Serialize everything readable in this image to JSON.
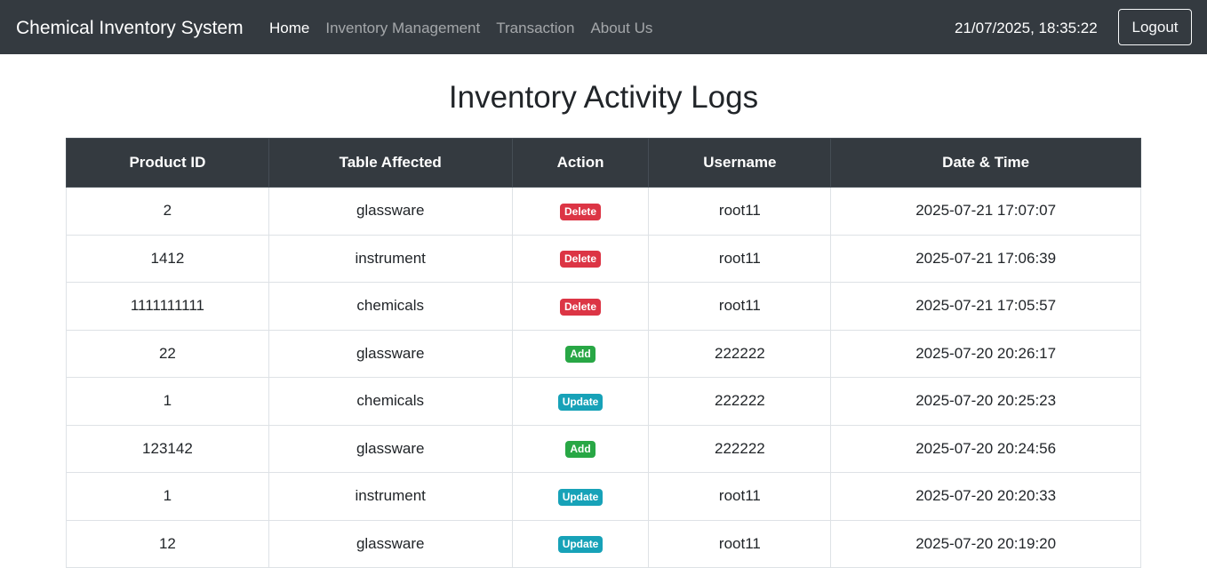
{
  "navbar": {
    "brand": "Chemical Inventory System",
    "links": [
      {
        "label": "Home",
        "active": true
      },
      {
        "label": "Inventory Management",
        "active": false
      },
      {
        "label": "Transaction",
        "active": false
      },
      {
        "label": "About Us",
        "active": false
      }
    ],
    "datetime": "21/07/2025, 18:35:22",
    "logout_label": "Logout"
  },
  "page": {
    "title": "Inventory Activity Logs"
  },
  "table": {
    "headers": [
      "Product ID",
      "Table Affected",
      "Action",
      "Username",
      "Date & Time"
    ],
    "rows": [
      {
        "product_id": "2",
        "table": "glassware",
        "action": "Delete",
        "username": "root11",
        "datetime": "2025-07-21 17:07:07"
      },
      {
        "product_id": "1412",
        "table": "instrument",
        "action": "Delete",
        "username": "root11",
        "datetime": "2025-07-21 17:06:39"
      },
      {
        "product_id": "1111111111",
        "table": "chemicals",
        "action": "Delete",
        "username": "root11",
        "datetime": "2025-07-21 17:05:57"
      },
      {
        "product_id": "22",
        "table": "glassware",
        "action": "Add",
        "username": "222222",
        "datetime": "2025-07-20 20:26:17"
      },
      {
        "product_id": "1",
        "table": "chemicals",
        "action": "Update",
        "username": "222222",
        "datetime": "2025-07-20 20:25:23"
      },
      {
        "product_id": "123142",
        "table": "glassware",
        "action": "Add",
        "username": "222222",
        "datetime": "2025-07-20 20:24:56"
      },
      {
        "product_id": "1",
        "table": "instrument",
        "action": "Update",
        "username": "root11",
        "datetime": "2025-07-20 20:20:33"
      },
      {
        "product_id": "12",
        "table": "glassware",
        "action": "Update",
        "username": "root11",
        "datetime": "2025-07-20 20:19:20"
      }
    ]
  },
  "colors": {
    "navbar_bg": "#343a40",
    "delete": "#dc3545",
    "add": "#28a745",
    "update": "#17a2b8"
  }
}
